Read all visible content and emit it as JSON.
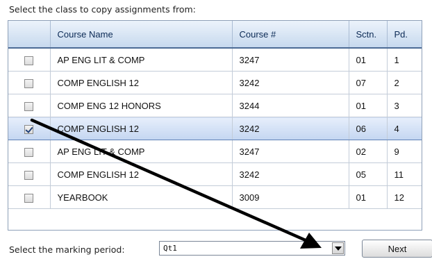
{
  "instruction": "Select the class to copy assignments from:",
  "table": {
    "headers": {
      "select": "",
      "course_name": "Course Name",
      "course_number": "Course #",
      "section": "Sctn.",
      "period": "Pd."
    },
    "rows": [
      {
        "checked": false,
        "course_name": "AP ENG LIT & COMP",
        "course_number": "3247",
        "section": "01",
        "period": "1"
      },
      {
        "checked": false,
        "course_name": "COMP ENGLISH 12",
        "course_number": "3242",
        "section": "07",
        "period": "2"
      },
      {
        "checked": false,
        "course_name": "COMP ENG 12 HONORS",
        "course_number": "3244",
        "section": "01",
        "period": "3"
      },
      {
        "checked": true,
        "course_name": "COMP ENGLISH 12",
        "course_number": "3242",
        "section": "06",
        "period": "4"
      },
      {
        "checked": false,
        "course_name": "AP ENG LIT & COMP",
        "course_number": "3247",
        "section": "02",
        "period": "9"
      },
      {
        "checked": false,
        "course_name": "COMP ENGLISH 12",
        "course_number": "3242",
        "section": "05",
        "period": "11"
      },
      {
        "checked": false,
        "course_name": "YEARBOOK",
        "course_number": "3009",
        "section": "01",
        "period": "12"
      }
    ]
  },
  "marking_period": {
    "label": "Select the marking period:",
    "selected": "Qt1"
  },
  "next_button": {
    "label": "Next"
  },
  "icons": {
    "dropdown": "chevron-down-icon",
    "annotation": "arrow-icon"
  },
  "colors": {
    "header_text": "#0b2a55",
    "selected_row": "#c4d6f1",
    "border": "#8ea0b8"
  }
}
